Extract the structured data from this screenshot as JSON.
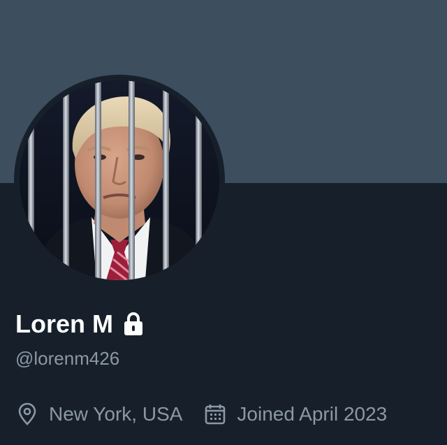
{
  "profile": {
    "display_name": "Loren M",
    "handle": "@lorenm426",
    "protected_icon": "lock-icon",
    "location": "New York, USA",
    "location_icon": "location-pin-icon",
    "joined": "Joined April 2023",
    "joined_icon": "calendar-icon"
  },
  "colors": {
    "banner": "#3d4e5e",
    "background": "#17202a",
    "primary_text": "#ffffff",
    "secondary_text": "#8b98a5"
  }
}
